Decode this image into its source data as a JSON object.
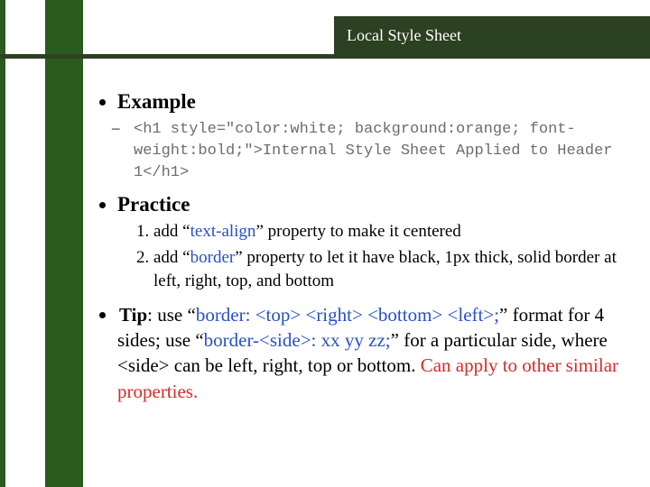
{
  "title": "Local Style Sheet",
  "example": {
    "heading": "Example",
    "code": "<h1 style=\"color:white; background:orange; font-weight:bold;\">Internal Style Sheet Applied to Header 1</h1>"
  },
  "practice": {
    "heading": "Practice",
    "items": [
      {
        "pre": "add “",
        "prop": "text-align",
        "post": "” property to make it centered"
      },
      {
        "pre": "add “",
        "prop": "border",
        "post": "” property to let it have black, 1px thick, solid border at left, right, top, and bottom"
      }
    ]
  },
  "tip": {
    "label": "Tip",
    "t1": ": use “",
    "b1": "border: <top> <right> <bottom> <left>;",
    "t2": "” format for 4 sides; use “",
    "b2": "border-<side>: xx yy zz;",
    "t3": "” for a particular side, where <side> can be ",
    "t4": "left, right, top or bottom.",
    "red": "Can apply to other similar properties."
  }
}
